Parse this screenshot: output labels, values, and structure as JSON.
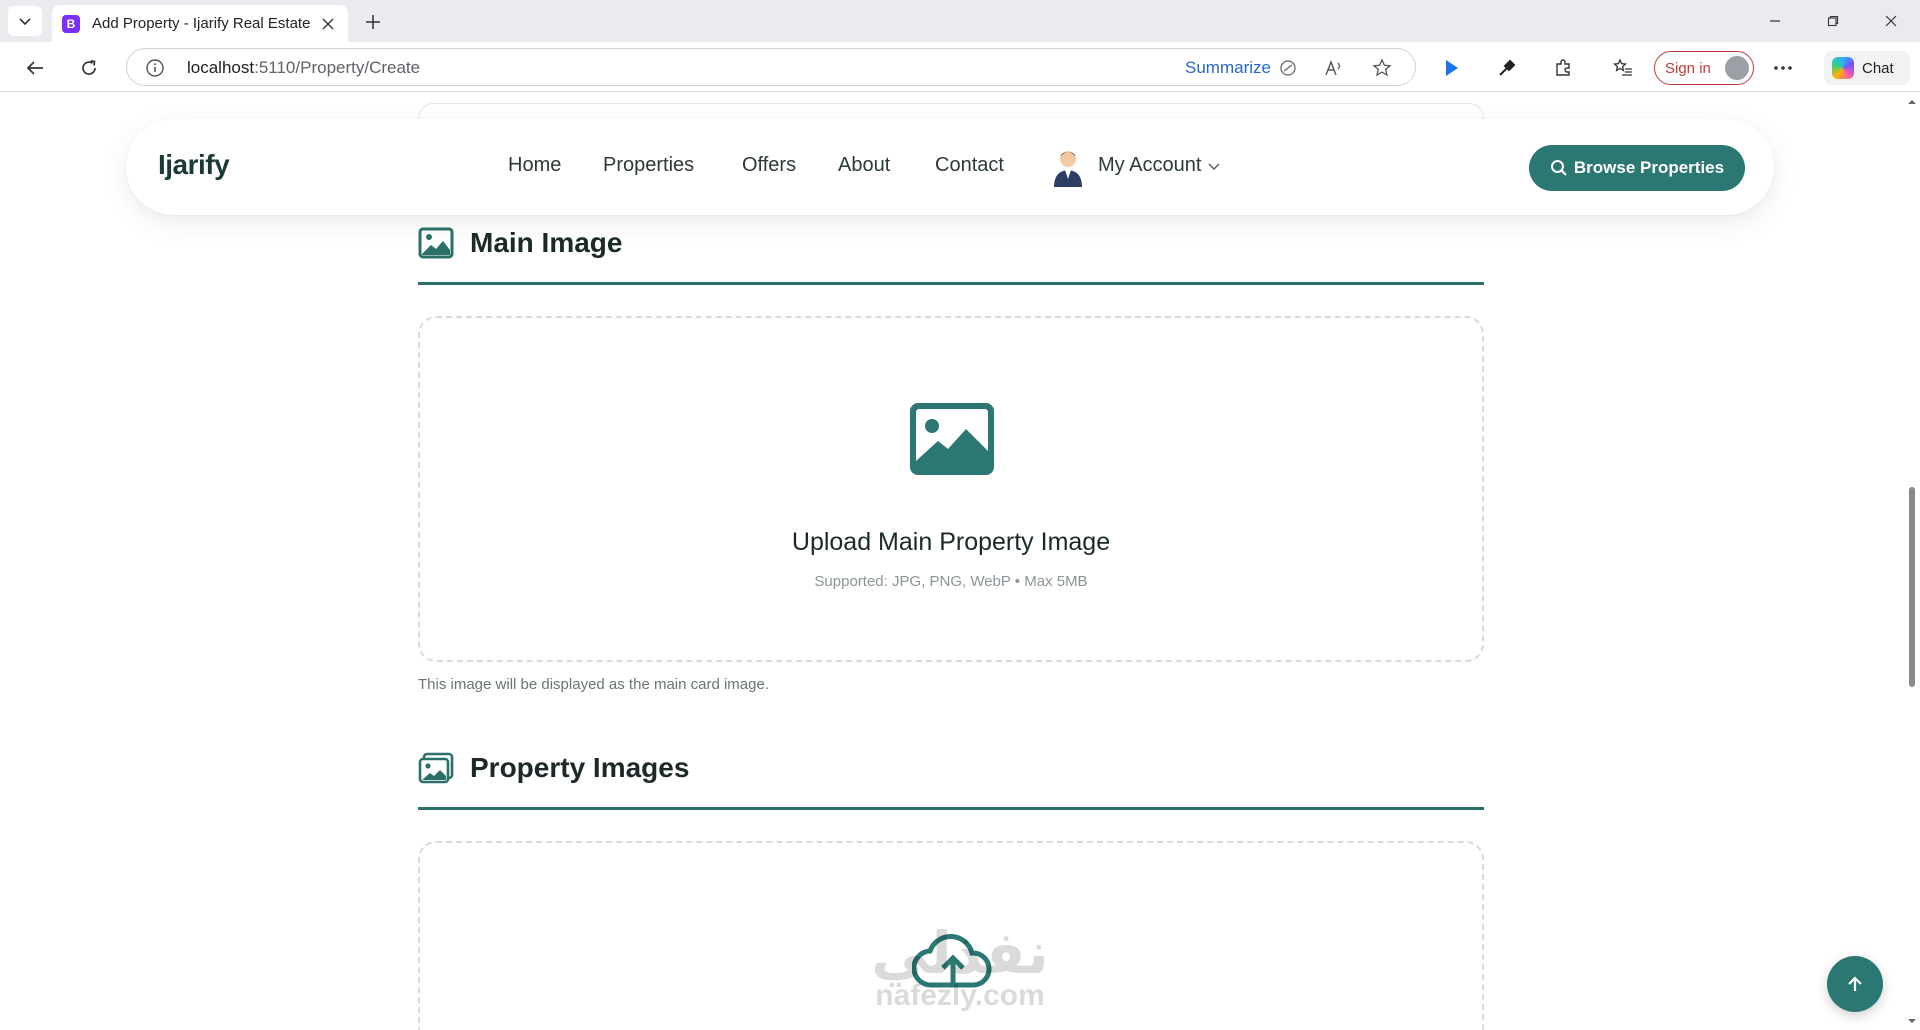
{
  "browser": {
    "tab_title": "Add Property - Ijarify Real Estate",
    "tab_favicon_letter": "B",
    "url_host": "localhost",
    "url_path": ":5110/Property/Create",
    "summarize_label": "Summarize",
    "signin_label": "Sign in",
    "chat_label": "Chat"
  },
  "navbar": {
    "brand": "Ijarify",
    "links": [
      "Home",
      "Properties",
      "Offers",
      "About",
      "Contact"
    ],
    "account_label": "My Account",
    "browse_button": "Browse Properties"
  },
  "main_image": {
    "section_title": "Main Image",
    "upload_title": "Upload Main Property Image",
    "supported": "Supported: JPG, PNG, WebP • Max 5MB",
    "help": "This image will be displayed as the main card image."
  },
  "property_images": {
    "section_title": "Property Images"
  },
  "watermark": {
    "arabic": "نفذلي",
    "latin": "nafezly.com"
  },
  "colors": {
    "accent": "#2b7873",
    "section_line": "#2b6f69",
    "dropzone_border": "#d6dbde"
  }
}
